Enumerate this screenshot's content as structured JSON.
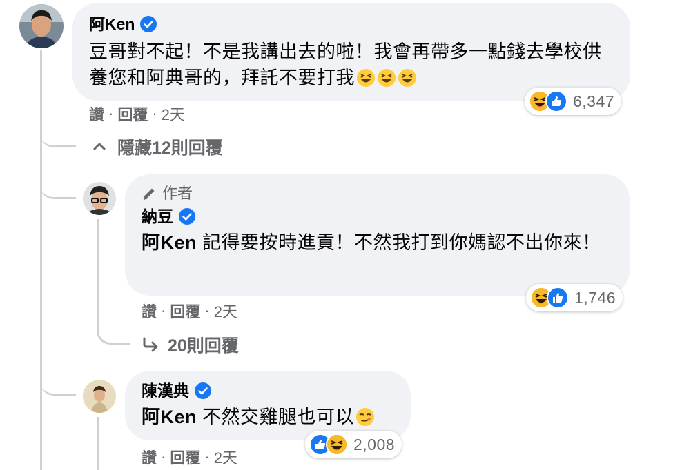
{
  "comments": [
    {
      "author": "阿Ken",
      "text": "豆哥對不起！不是我講出去的啦！我會再帶多一點錢去學校供養您和阿典哥的，拜託不要打我",
      "emojis": [
        "grinning-squinting",
        "grinning-squinting",
        "grinning-squinting"
      ],
      "reactions": [
        "haha",
        "like"
      ],
      "reaction_count": "6,347",
      "actions": {
        "like": "讚",
        "reply": "回覆",
        "time": "2天"
      }
    },
    {
      "badge": "作者",
      "author": "納豆",
      "mention": "阿Ken",
      "text": " 記得要按時進貢！不然我打到你媽認不出你來！",
      "reactions": [
        "haha",
        "like"
      ],
      "reaction_count": "1,746",
      "actions": {
        "like": "讚",
        "reply": "回覆",
        "time": "2天"
      }
    },
    {
      "author": "陳漢典",
      "mention": "阿Ken",
      "text": " 不然交雞腿也可以",
      "emojis": [
        "smirk"
      ],
      "reactions": [
        "like",
        "haha"
      ],
      "reaction_count": "2,008",
      "actions": {
        "like": "讚",
        "reply": "回覆",
        "time": "2天"
      }
    }
  ],
  "toggles": {
    "hide_replies": "隱藏12則回覆",
    "more_replies": "20則回覆"
  },
  "separator": "·",
  "colors": {
    "bubble": "#f0f2f5",
    "verified": "#1877f2",
    "meta": "#65676b",
    "thread": "#ced0d4"
  }
}
